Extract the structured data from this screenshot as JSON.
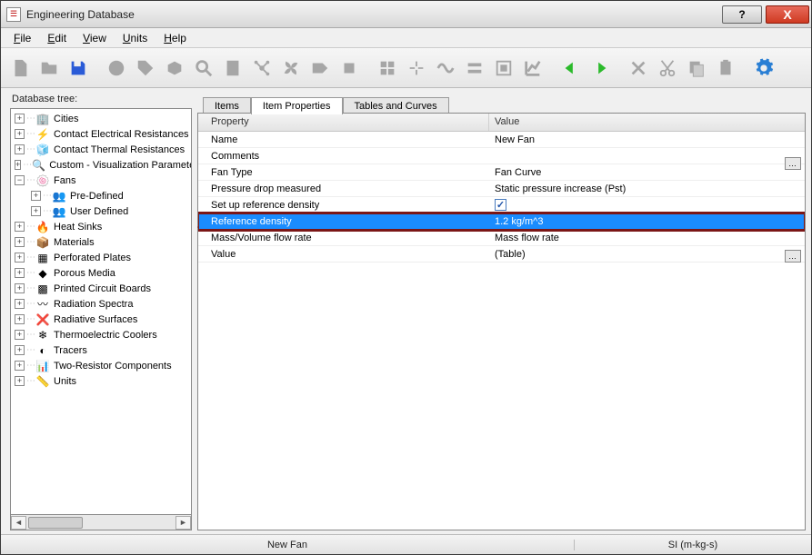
{
  "window": {
    "title": "Engineering Database"
  },
  "menu": {
    "file": "File",
    "edit": "Edit",
    "view": "View",
    "units": "Units",
    "help": "Help"
  },
  "tree_label": "Database tree:",
  "tree": [
    {
      "label": "Cities",
      "icon": "🏢",
      "depth": 0,
      "exp": "+"
    },
    {
      "label": "Contact Electrical Resistances",
      "icon": "⚡",
      "depth": 0,
      "exp": "+"
    },
    {
      "label": "Contact Thermal Resistances",
      "icon": "🧊",
      "depth": 0,
      "exp": "+"
    },
    {
      "label": "Custom - Visualization Parameters",
      "icon": "🔍",
      "depth": 0,
      "exp": "+"
    },
    {
      "label": "Fans",
      "icon": "🍥",
      "depth": 0,
      "exp": "−"
    },
    {
      "label": "Pre-Defined",
      "icon": "👥",
      "depth": 1,
      "exp": "+"
    },
    {
      "label": "User Defined",
      "icon": "👥",
      "depth": 1,
      "exp": "+"
    },
    {
      "label": "Heat Sinks",
      "icon": "🔥",
      "depth": 0,
      "exp": "+"
    },
    {
      "label": "Materials",
      "icon": "📦",
      "depth": 0,
      "exp": "+"
    },
    {
      "label": "Perforated Plates",
      "icon": "▦",
      "depth": 0,
      "exp": "+"
    },
    {
      "label": "Porous Media",
      "icon": "◆",
      "depth": 0,
      "exp": "+"
    },
    {
      "label": "Printed Circuit Boards",
      "icon": "▩",
      "depth": 0,
      "exp": "+"
    },
    {
      "label": "Radiation Spectra",
      "icon": "〰",
      "depth": 0,
      "exp": "+"
    },
    {
      "label": "Radiative Surfaces",
      "icon": "❌",
      "depth": 0,
      "exp": "+"
    },
    {
      "label": "Thermoelectric Coolers",
      "icon": "❄",
      "depth": 0,
      "exp": "+"
    },
    {
      "label": "Tracers",
      "icon": "◐",
      "depth": 0,
      "exp": "+"
    },
    {
      "label": "Two-Resistor Components",
      "icon": "📊",
      "depth": 0,
      "exp": "+"
    },
    {
      "label": "Units",
      "icon": "📏",
      "depth": 0,
      "exp": "+"
    }
  ],
  "tabs": {
    "items": "Items",
    "props": "Item Properties",
    "tables": "Tables and Curves"
  },
  "grid": {
    "head_prop": "Property",
    "head_val": "Value",
    "rows": [
      {
        "prop": "Name",
        "val": "New Fan"
      },
      {
        "prop": "Comments",
        "val": "",
        "ellipsis": true
      },
      {
        "prop": "Fan Type",
        "val": "Fan Curve"
      },
      {
        "prop": "Pressure drop measured",
        "val": "Static pressure increase (Pst)"
      },
      {
        "prop": "Set up reference density",
        "val": "",
        "checkbox": true
      },
      {
        "prop": "Reference density",
        "val": "1.2 kg/m^3",
        "selected": true
      },
      {
        "prop": "Mass/Volume flow rate",
        "val": "Mass flow rate"
      },
      {
        "prop": "Value",
        "val": "(Table)",
        "ellipsis": true
      }
    ]
  },
  "status": {
    "left": "New Fan",
    "right": "SI (m-kg-s)"
  },
  "winbtns": {
    "help": "?",
    "close": "X"
  }
}
